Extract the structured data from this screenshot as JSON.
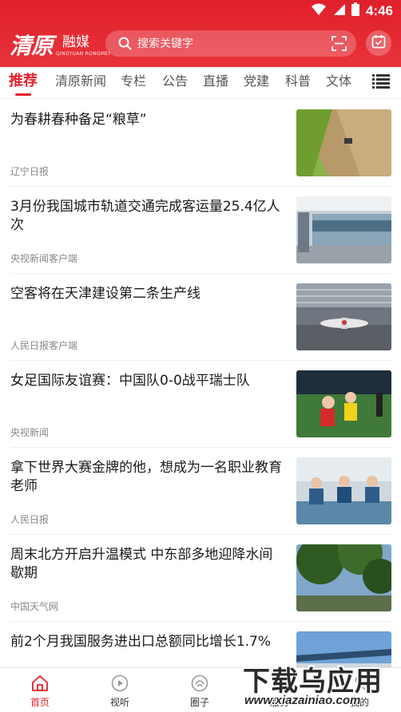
{
  "status_bar": {
    "time": "4:46"
  },
  "header": {
    "logo_text": "清原",
    "logo_sub": "融媒",
    "logo_en": "QINGYUAN RONGMEI",
    "search_placeholder": "搜索关键字"
  },
  "tabs": [
    {
      "label": "推荐",
      "active": true
    },
    {
      "label": "清原新闻"
    },
    {
      "label": "专栏"
    },
    {
      "label": "公告"
    },
    {
      "label": "直播"
    },
    {
      "label": "党建"
    },
    {
      "label": "科普"
    },
    {
      "label": "文体"
    }
  ],
  "news": [
    {
      "title": "为春耕春种备足“粮草”",
      "source": "辽宁日报"
    },
    {
      "title": "3月份我国城市轨道交通完成客运量25.4亿人次",
      "source": "央视新闻客户端"
    },
    {
      "title": "空客将在天津建设第二条生产线",
      "source": "人民日报客户端"
    },
    {
      "title": "女足国际友谊赛：中国队0-0战平瑞士队",
      "source": "央视新闻"
    },
    {
      "title": "拿下世界大赛金牌的他，想成为一名职业教育老师",
      "source": "人民日报"
    },
    {
      "title": "周末北方开启升温模式 中东部多地迎降水间歇期",
      "source": "中国天气网"
    },
    {
      "title": "前2个月我国服务进出口总额同比增长1.7%",
      "source": ""
    }
  ],
  "bottom_nav": [
    {
      "label": "首页",
      "icon": "home-icon",
      "active": true
    },
    {
      "label": "视听",
      "icon": "play-icon"
    },
    {
      "label": "圈子",
      "icon": "circle-icon"
    },
    {
      "label": "服务",
      "icon": "service-icon"
    },
    {
      "label": "我的",
      "icon": "user-icon"
    }
  ],
  "watermark": {
    "text": "下载乌应用",
    "url": "www.xiazainiao.com"
  },
  "colors": {
    "brand_red": "#e0202a"
  }
}
